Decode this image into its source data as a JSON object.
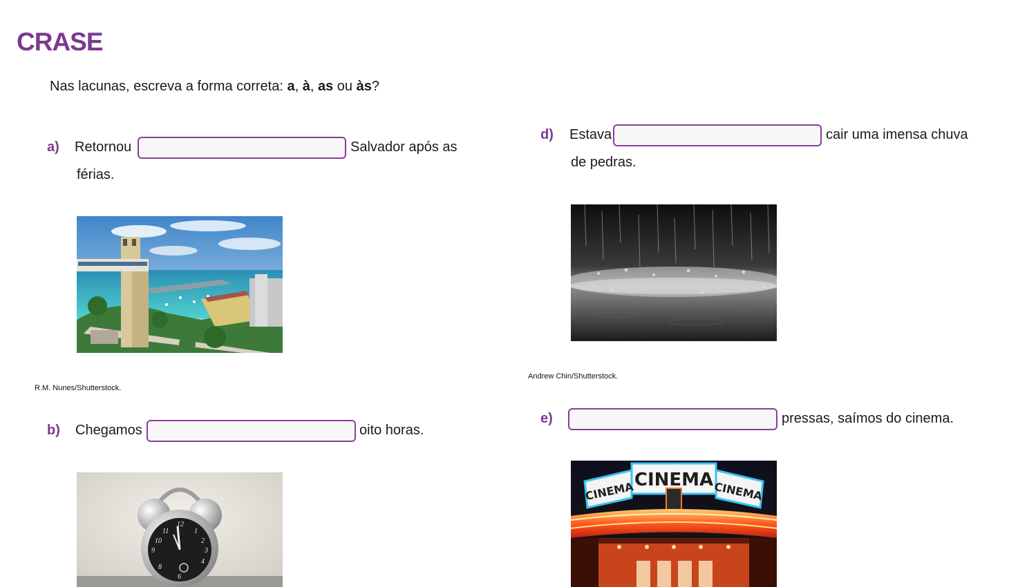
{
  "title": "CRASE",
  "instruction": {
    "pre": "Nas lacunas, escreva a forma correta: ",
    "opt1": "a",
    "sep1": ", ",
    "opt2": "à",
    "sep2": ", ",
    "opt3": "as",
    "sep3": " ou ",
    "opt4": "às",
    "end": "?"
  },
  "questions": [
    {
      "letter": "a)",
      "before": "Retornou",
      "after": "Salvador após as",
      "line2": "férias.",
      "answer": "",
      "credit": "R.M. Nunes/Shutterstock.",
      "image": "salvador-city-photo"
    },
    {
      "letter": "b)",
      "before": "Chegamos",
      "after": "oito horas.",
      "answer": "",
      "image": "alarm-clock-photo"
    },
    {
      "letter": "d)",
      "before": "Estava",
      "after": "cair uma imensa chuva",
      "line2": "de pedras.",
      "answer": "",
      "credit": "Andrew Chin/Shutterstock.",
      "image": "heavy-rain-photo"
    },
    {
      "letter": "e)",
      "before": "",
      "after": "pressas, saímos do cinema.",
      "answer": "",
      "image": "cinema-facade-photo"
    }
  ],
  "cinema_signs": [
    "CINEMA",
    "CINEMA",
    "CINEMA"
  ],
  "colors": {
    "accent": "#7b3a8f",
    "blank_border": "#8a3d99"
  }
}
